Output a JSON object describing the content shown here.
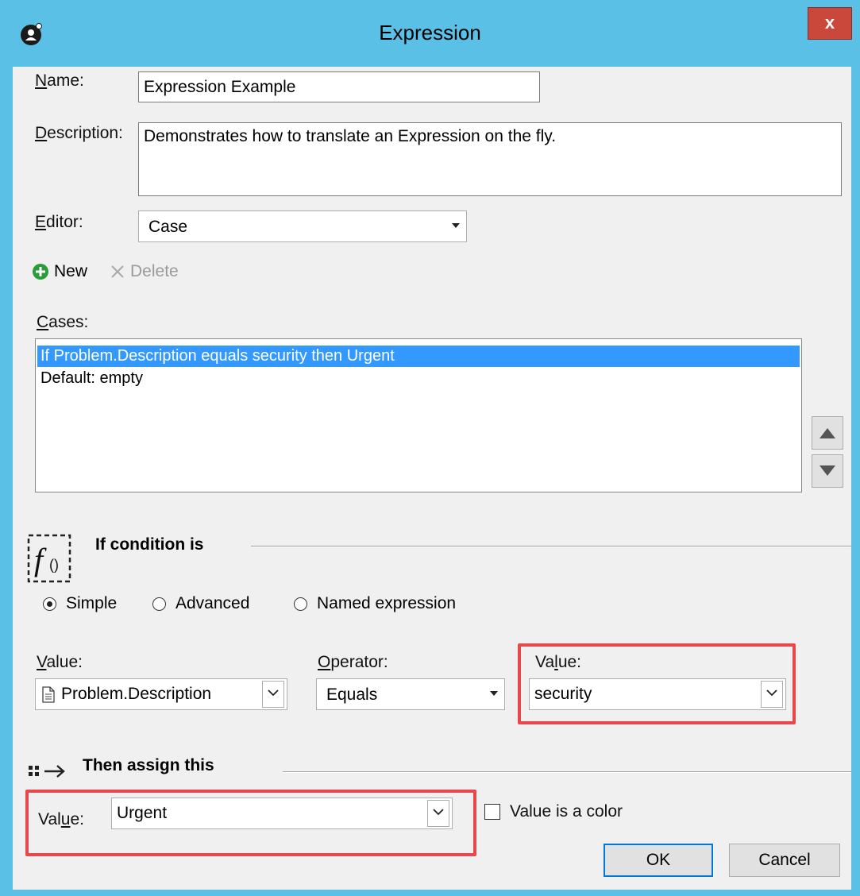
{
  "window": {
    "title": "Expression",
    "close_label": "x"
  },
  "form": {
    "name_label_pre": "",
    "name_label_key": "N",
    "name_label_post": "ame:",
    "name_value": "Expression Example",
    "description_label_pre": "",
    "description_label_key": "D",
    "description_label_post": "escription:",
    "description_value": "Demonstrates how to translate an Expression on the fly.",
    "editor_label_pre": "",
    "editor_label_key": "E",
    "editor_label_post": "ditor:",
    "editor_value": "Case"
  },
  "toolbar": {
    "new_label": "New",
    "delete_label": "Delete"
  },
  "cases": {
    "label_pre": "",
    "label_key": "C",
    "label_post": "ases:",
    "items": [
      {
        "text": "If Problem.Description equals security then Urgent",
        "selected": true
      },
      {
        "text": "Default: empty",
        "selected": false
      }
    ]
  },
  "condition": {
    "title": "If condition is",
    "icon": "function-icon",
    "radios": [
      {
        "label": "Simple",
        "checked": true
      },
      {
        "label": "Advanced",
        "checked": false
      },
      {
        "label": "Named expression",
        "checked": false
      }
    ],
    "value_label_pre": "",
    "value_label_key": "V",
    "value_label_post": "alue:",
    "value_field": "Problem.Description",
    "operator_label_pre": "",
    "operator_label_key": "O",
    "operator_label_post": "perator:",
    "operator_value": "Equals",
    "value2_label_pre": "Va",
    "value2_label_key": "l",
    "value2_label_post": "ue:",
    "value2_field": "security"
  },
  "assign": {
    "title": "Then assign this",
    "value_label_pre": "Val",
    "value_label_key": "u",
    "value_label_post": "e:",
    "value_field": "Urgent",
    "color_checkbox_label": "Value is a color"
  },
  "buttons": {
    "ok": "OK",
    "cancel": "Cancel"
  },
  "colors": {
    "titlebar": "#5bc0e6",
    "close": "#c9473b",
    "selection": "#3399ff",
    "highlight": "#e8474b"
  }
}
